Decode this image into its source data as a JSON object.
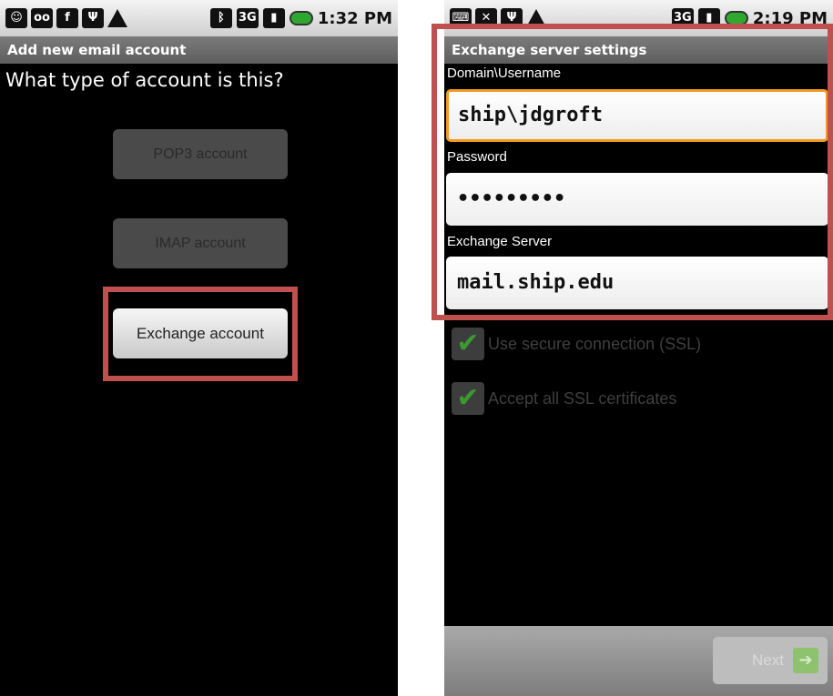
{
  "left_screen": {
    "status": {
      "time": "1:32 PM"
    },
    "title": "Add new email account",
    "question": "What type of account is this?",
    "buttons": {
      "pop3": "POP3 account",
      "imap": "IMAP account",
      "exchange": "Exchange account"
    }
  },
  "right_screen": {
    "status": {
      "time": "2:19 PM"
    },
    "title": "Exchange server settings",
    "fields": {
      "username_label": "Domain\\Username",
      "username_value": "ship\\jdgroft",
      "password_label": "Password",
      "password_value": "•••••••••",
      "server_label": "Exchange Server",
      "server_value": "mail.ship.edu"
    },
    "checkboxes": {
      "ssl": "Use secure connection (SSL)",
      "accept_certs": "Accept all SSL certificates"
    },
    "next_label": "Next"
  },
  "colors": {
    "highlight": "#c0504d",
    "focus_border": "#f39a1f",
    "check_green": "#3b9a2f"
  }
}
